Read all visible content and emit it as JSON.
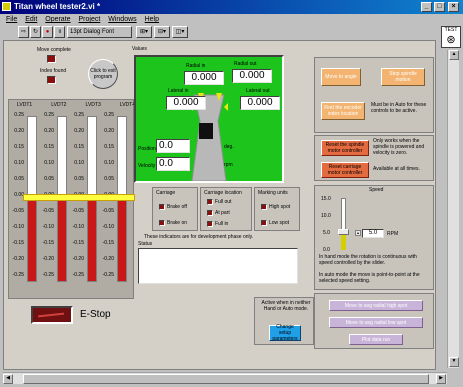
{
  "window": {
    "title": "Titan wheel tester2.vi *"
  },
  "menu": [
    "File",
    "Edit",
    "Operate",
    "Project",
    "Windows",
    "Help"
  ],
  "toolbar": {
    "font": "13pt Dialog Font"
  },
  "status": {
    "move_complete": "Move complete",
    "index_found": "Index found",
    "exit_button": "Click to exit program"
  },
  "lvdt": {
    "headers": [
      "LVDT1",
      "LVDT2",
      "LVDT3",
      "LVDT4"
    ],
    "ticks": [
      "0.25",
      "0.20",
      "0.15",
      "0.10",
      "0.05",
      "0.00",
      "-0.05",
      "-0.10",
      "-0.15",
      "-0.20",
      "-0.25"
    ],
    "values": [
      0.0,
      0.0,
      0.0,
      0.0
    ]
  },
  "values": {
    "title": "Values",
    "radial_in_label": "Radial in",
    "radial_in": "0.000",
    "radial_out_label": "Radial out",
    "radial_out": "0.000",
    "lateral_in_label": "Lateral in",
    "lateral_in": "0.000",
    "lateral_out_label": "Lateral out",
    "lateral_out": "0.000",
    "position_label": "Position",
    "position": "0.0",
    "position_unit": "deg.",
    "velocity_label": "Velocity",
    "velocity": "0.0",
    "velocity_unit": "rpm"
  },
  "controls": {
    "move_to_angle": "Move to angle",
    "stop_spindle": "Stop spindle motion",
    "find_index": "Find the encoder index location",
    "auto_note": "Must be in Auto for these controls to be active.",
    "reset_spindle": "Reset the spindle motor controller",
    "reset_spindle_note": "Only works when the spindle is powered and velocity is zero.",
    "reset_carriage": "Reset carriage motor controller",
    "reset_carriage_note": "Available at all times."
  },
  "indicators": {
    "carriage_title": "Carriage",
    "brake_off": "Brake off",
    "brake_on": "Brake on",
    "location_title": "Carriage location",
    "full_out": "Full out",
    "at_part": "At part",
    "full_in": "Full in",
    "marking_title": "Marking units",
    "high_spot": "High spot",
    "low_spot": "Low spot",
    "dev_note": "These indicators are for development phase only.",
    "status_label": "Status"
  },
  "speed": {
    "title": "Speed",
    "ticks": [
      "15.0",
      "10.0",
      "5.0",
      "0.0"
    ],
    "value": "5.0",
    "unit": "RPM",
    "note1": "In hand mode the rotation is continuous with speed controlled by the slider.",
    "note2": "In auto mode the move is point-to-point at the selected speed setting."
  },
  "estop": {
    "label": "E-Stop"
  },
  "params": {
    "note": "Active when in neither Hand or Auto mode.",
    "button": "Change setup parameters"
  },
  "moves": {
    "high": "Move to avg radial high spot",
    "low": "Move to avg radial low spot",
    "plot": "Plot data run"
  }
}
